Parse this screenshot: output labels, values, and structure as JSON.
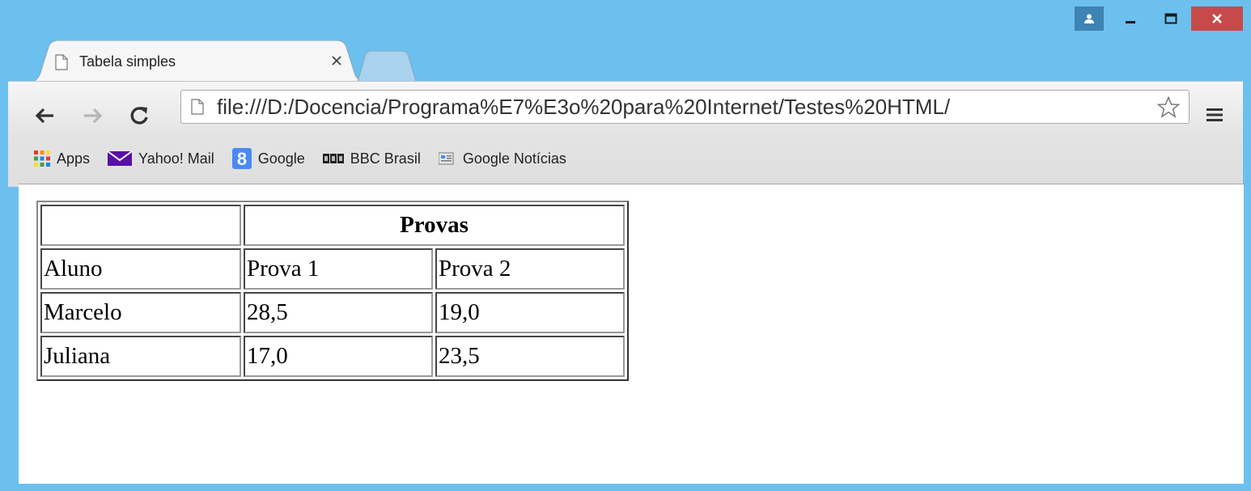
{
  "window": {
    "controls": {
      "user": "user-icon",
      "minimize": "minimize-icon",
      "maximize": "maximize-icon",
      "close": "close-icon"
    }
  },
  "tab": {
    "title": "Tabela simples"
  },
  "omnibox": {
    "url": "file:///D:/Docencia/Programa%E7%E3o%20para%20Internet/Testes%20HTML/"
  },
  "bookmarks": [
    {
      "label": "Apps",
      "icon": "apps-grid-icon"
    },
    {
      "label": "Yahoo! Mail",
      "icon": "yahoo-mail-icon"
    },
    {
      "label": "Google",
      "icon": "google-icon"
    },
    {
      "label": "BBC Brasil",
      "icon": "bbc-icon"
    },
    {
      "label": "Google Notícias",
      "icon": "google-news-icon"
    }
  ],
  "table": {
    "header": {
      "blank": "",
      "group": "Provas"
    },
    "columns": [
      "Aluno",
      "Prova 1",
      "Prova 2"
    ],
    "rows": [
      [
        "Marcelo",
        "28,5",
        "19,0"
      ],
      [
        "Juliana",
        "17,0",
        "23,5"
      ]
    ]
  },
  "colors": {
    "frame": "#6cc0ee",
    "close": "#c74a4a",
    "user": "#3d83b4"
  }
}
